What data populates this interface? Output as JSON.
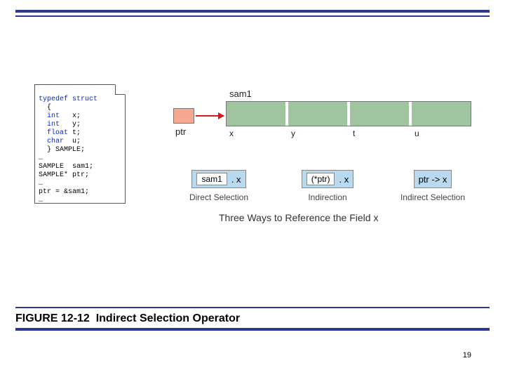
{
  "figure_number": "FIGURE 12-12",
  "figure_title": "Indirect Selection Operator",
  "page_number": "19",
  "code": {
    "line1_kw": "typedef struct",
    "line2": "  {",
    "line3a": "  int",
    "line3b": "   x;",
    "line4a": "  int",
    "line4b": "   y;",
    "line5a": "  float",
    "line5b": " t;",
    "line6a": "  char",
    "line6b": "  u;",
    "line7": "  } SAMPLE;",
    "line8": "…",
    "line9": "SAMPLE  sam1;",
    "line10": "SAMPLE* ptr;",
    "line11": "…",
    "line12": "ptr = &sam1;",
    "line13": "…"
  },
  "mem": {
    "struct_label": "sam1",
    "ptr_label": "ptr",
    "fields": {
      "f0": "x",
      "f1": "y",
      "f2": "t",
      "f3": "u"
    }
  },
  "refs": {
    "r1_inner": "sam1",
    "r1_op": ".  x",
    "r1_label": "Direct Selection",
    "r2_inner": "(*ptr)",
    "r2_op": ".  x",
    "r2_label": "Indirection",
    "r3_text": "ptr  ->  x",
    "r3_label": "Indirect Selection"
  },
  "subtitle": "Three Ways to Reference the Field x"
}
